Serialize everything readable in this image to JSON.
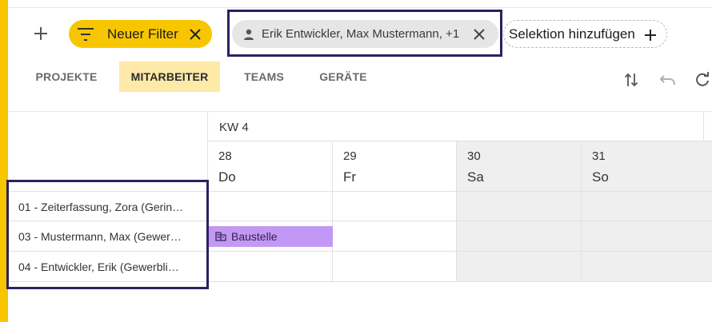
{
  "filter_bar": {
    "filter_chip_label": "Neuer Filter",
    "selection_chip_label": "Erik Entwickler, Max Mustermann, +1",
    "add_selection_label": "Selektion hinzufügen"
  },
  "tabs": [
    {
      "label": "PROJEKTE",
      "active": false
    },
    {
      "label": "MITARBEITER",
      "active": true
    },
    {
      "label": "TEAMS",
      "active": false
    },
    {
      "label": "GERÄTE",
      "active": false
    }
  ],
  "toolbar": {
    "icons": [
      "sort-icon",
      "undo-icon",
      "refresh-icon"
    ]
  },
  "calendar": {
    "week_label": "KW 4",
    "days": [
      {
        "num": "28",
        "name": "Do",
        "weekend": false
      },
      {
        "num": "29",
        "name": "Fr",
        "weekend": false
      },
      {
        "num": "30",
        "name": "Sa",
        "weekend": true
      },
      {
        "num": "31",
        "name": "So",
        "weekend": true
      }
    ],
    "employees": [
      "01 - Zeiterfassung, Zora (Gerin…",
      "03 - Mustermann, Max (Gewer…",
      "04 - Entwickler, Erik (Gewerbli…"
    ],
    "event": {
      "label": "Baustelle",
      "icon": "building-icon"
    }
  },
  "colors": {
    "accent_yellow": "#f7c600",
    "active_tab_bg": "#fde9a8",
    "highlight_border": "#2c2161",
    "event_purple": "#c398f5",
    "weekend_bg": "#efefef"
  }
}
